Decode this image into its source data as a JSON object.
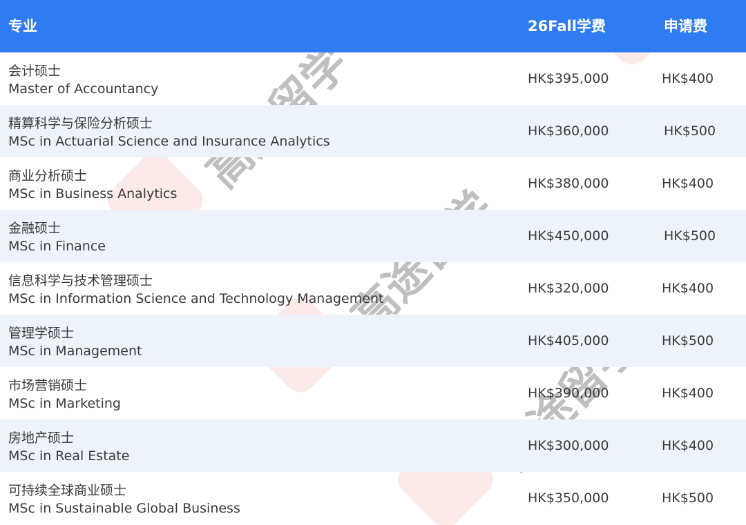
{
  "header": {
    "major": "专业",
    "tuition": "26Fall学费",
    "fee": "申请费"
  },
  "rows": [
    {
      "cn": "会计硕士",
      "en": "Master of Accountancy",
      "tuition": "HK$395,000",
      "fee": "HK$400"
    },
    {
      "cn": "精算科学与保险分析硕士",
      "en": "MSc in Actuarial Science and Insurance Analytics",
      "tuition": "HK$360,000",
      "fee": "HK$500"
    },
    {
      "cn": "商业分析硕士",
      "en": "MSc in Business Analytics",
      "tuition": "HK$380,000",
      "fee": "HK$400"
    },
    {
      "cn": "金融硕士",
      "en": "MSc in Finance",
      "tuition": "HK$450,000",
      "fee": "HK$500"
    },
    {
      "cn": "信息科学与技术管理硕士",
      "en": "MSc in Information Science and Technology Management",
      "tuition": "HK$320,000",
      "fee": "HK$400"
    },
    {
      "cn": "管理学硕士",
      "en": "MSc in Management",
      "tuition": "HK$405,000",
      "fee": "HK$500"
    },
    {
      "cn": "市场营销硕士",
      "en": "MSc in Marketing",
      "tuition": "HK$390,000",
      "fee": "HK$400"
    },
    {
      "cn": "房地产硕士",
      "en": "MSc in Real Estate",
      "tuition": "HK$300,000",
      "fee": "HK$400"
    },
    {
      "cn": "可持续全球商业硕士",
      "en": "MSc in Sustainable Global Business",
      "tuition": "HK$350,000",
      "fee": "HK$500"
    }
  ],
  "watermark": {
    "text": "高途留学",
    "badge_color": "#e2332b"
  }
}
